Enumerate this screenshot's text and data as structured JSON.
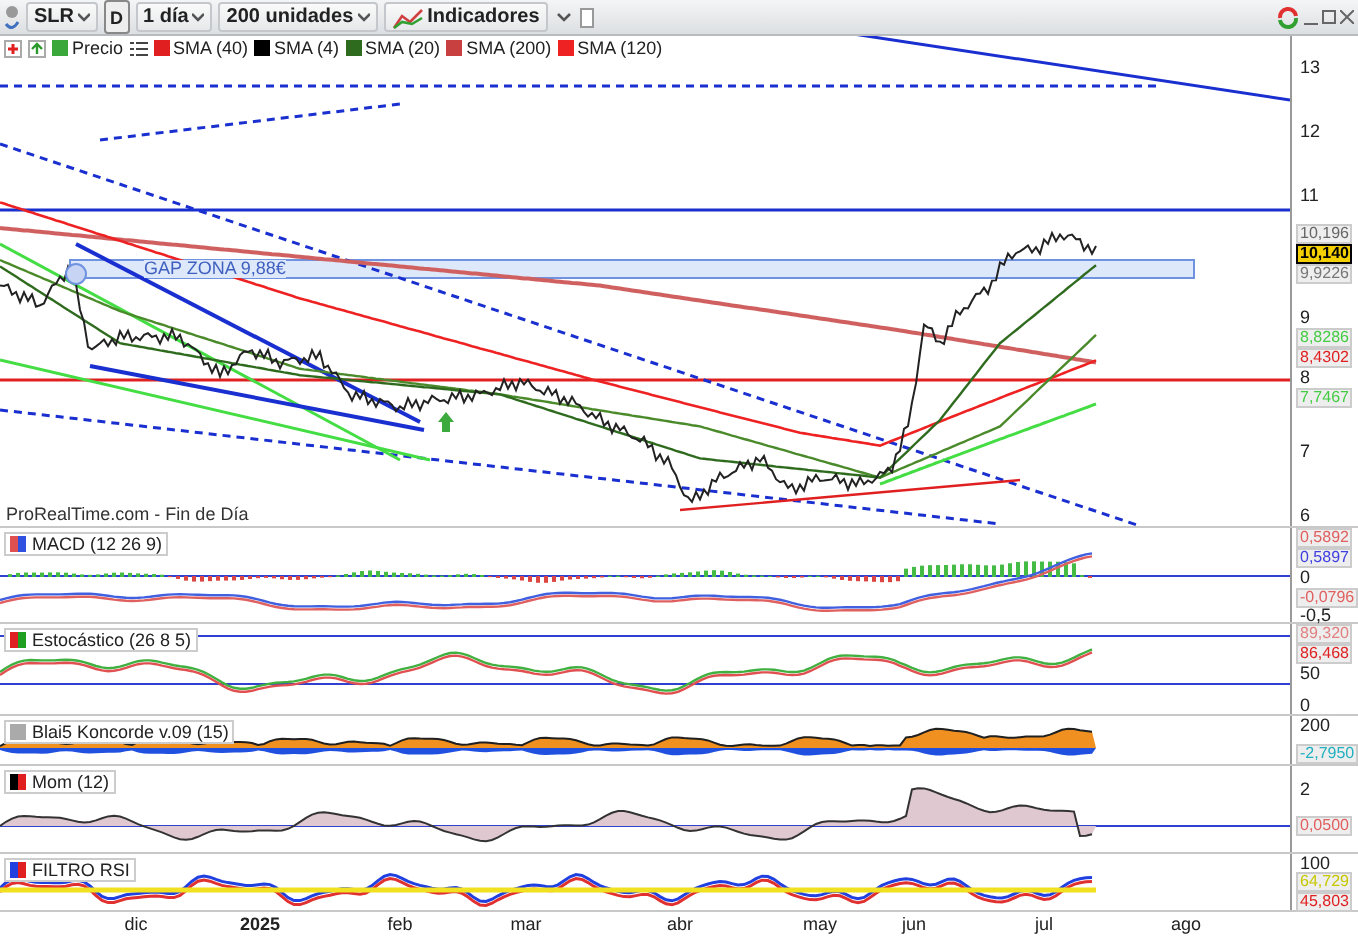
{
  "toolbar": {
    "symbol": "SLR",
    "period_badge": "D",
    "timeframe": "1 día",
    "units": "200 unidades",
    "indicators_button": "Indicadores"
  },
  "legend": [
    {
      "label": "Precio",
      "color": "#3aa83a"
    },
    {
      "label": "SMA (40)",
      "color": "#e02020"
    },
    {
      "label": "SMA (4)",
      "color": "#000000"
    },
    {
      "label": "SMA (20)",
      "color": "#2e6b1e"
    },
    {
      "label": "SMA (200)",
      "color": "#c84040"
    },
    {
      "label": "SMA (120)",
      "color": "#ee2222"
    }
  ],
  "main_chart": {
    "annotation": "GAP ZONA 9,88€",
    "source": "ProRealTime.com - Fin de Día",
    "ticks": [
      "13",
      "12",
      "11",
      "9",
      "8",
      "7",
      "6"
    ],
    "tags": [
      {
        "text": "10,196",
        "color": "#666666",
        "highlighted": false
      },
      {
        "text": "10,140",
        "color": "#000000",
        "highlighted": true
      },
      {
        "text": "9,9226",
        "color": "#777777",
        "highlighted": false
      },
      {
        "text": "8,8286",
        "color": "#44cc44",
        "highlighted": false
      },
      {
        "text": "8,4302",
        "color": "#e02020",
        "highlighted": false
      },
      {
        "text": "7,7467",
        "color": "#44cc44",
        "highlighted": false
      }
    ]
  },
  "indicator_panes": [
    {
      "kind": "macd",
      "title": "MACD (12 26 9)",
      "ticks": [
        "0",
        "-0,5"
      ],
      "tags": [
        {
          "text": "0,5892",
          "color": "#e06060",
          "highlighted": false
        },
        {
          "text": "0,5897",
          "color": "#4040e0",
          "highlighted": false
        },
        {
          "text": "-0,0796",
          "color": "#e06060",
          "highlighted": false
        }
      ]
    },
    {
      "kind": "stochastic",
      "title": "Estocástico (26 8 5)",
      "ticks": [
        "50",
        "0"
      ],
      "tags": [
        {
          "text": "89,320",
          "color": "#e08080",
          "highlighted": false
        },
        {
          "text": "86,468",
          "color": "#e02020",
          "highlighted": false
        }
      ]
    },
    {
      "kind": "koncorde",
      "title": "Blai5 Koncorde v.09 (15)",
      "ticks": [
        "200"
      ],
      "tags": [
        {
          "text": "-2,7950",
          "color": "#20b0c0",
          "highlighted": false
        }
      ]
    },
    {
      "kind": "momentum",
      "title": "Mom (12)",
      "ticks": [
        "2"
      ],
      "tags": [
        {
          "text": "0,0500",
          "color": "#e06060",
          "highlighted": false
        }
      ]
    },
    {
      "kind": "rsi",
      "title": "FILTRO RSI",
      "ticks": [
        "100"
      ],
      "tags": [
        {
          "text": "64,729",
          "color": "#c8c800",
          "highlighted": false
        },
        {
          "text": "45,803",
          "color": "#e02020",
          "highlighted": false
        }
      ]
    }
  ],
  "x_axis": [
    {
      "label": "dic",
      "emphasized": false
    },
    {
      "label": "2025",
      "emphasized": true
    },
    {
      "label": "feb",
      "emphasized": false
    },
    {
      "label": "mar",
      "emphasized": false
    },
    {
      "label": "abr",
      "emphasized": false
    },
    {
      "label": "may",
      "emphasized": false
    },
    {
      "label": "jun",
      "emphasized": false
    },
    {
      "label": "jul",
      "emphasized": false
    },
    {
      "label": "ago",
      "emphasized": false
    }
  ]
}
